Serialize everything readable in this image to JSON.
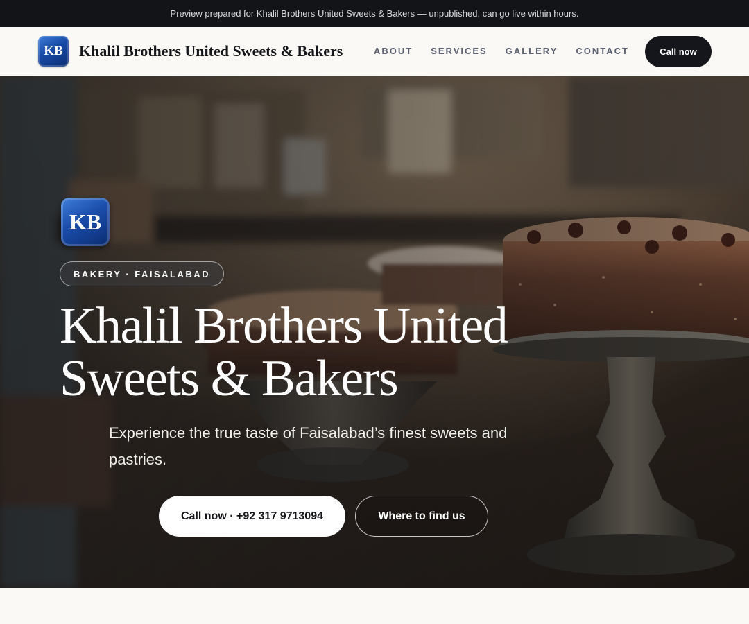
{
  "announcement": "Preview prepared for Khalil Brothers United Sweets & Bakers — unpublished, can go live within hours.",
  "header": {
    "logo_initials": "KB",
    "brand_name": "Khalil Brothers United Sweets & Bakers",
    "nav_links": [
      "ABOUT",
      "SERVICES",
      "GALLERY",
      "CONTACT"
    ],
    "cta_label": "Call now"
  },
  "hero": {
    "badge_initials": "KB",
    "category": "BAKERY · FAISALABAD",
    "title_line1": "Khalil Brothers United",
    "title_line2": "Sweets & Bakers",
    "subtitle": "Experience the true taste of Faisalabad’s finest sweets and pastries.",
    "primary_button": "Call now · +92 317 9713094",
    "secondary_button": "Where to find us"
  },
  "colors": {
    "topbar": "#121418",
    "nav_background": "#faf9f6",
    "dark_button": "#14161b",
    "logo_blue": "#174aa6"
  }
}
